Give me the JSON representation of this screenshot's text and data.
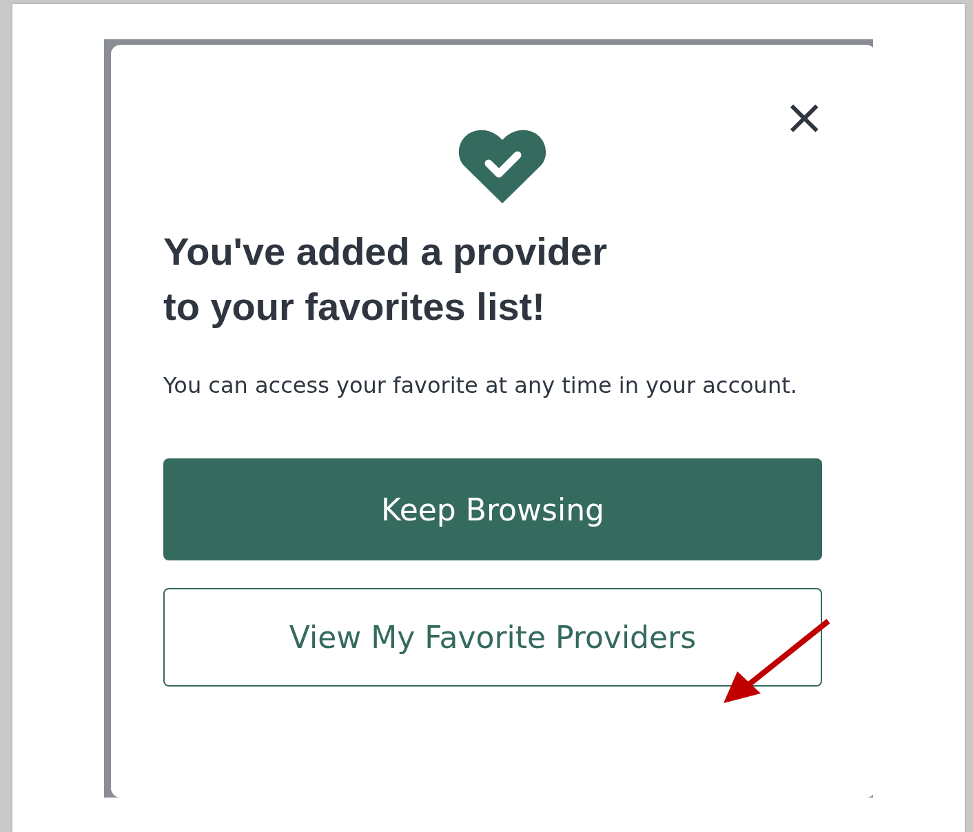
{
  "dialog": {
    "close_label": "×",
    "title_lines": [
      "You've added a provider",
      "to your favorites list!"
    ],
    "message": "You can access your favorite at any time in your account.",
    "buttons": [
      {
        "label": "Keep Browsing",
        "kind": "primary"
      },
      {
        "label": "View My Favorite Providers",
        "kind": "secondary"
      }
    ]
  }
}
